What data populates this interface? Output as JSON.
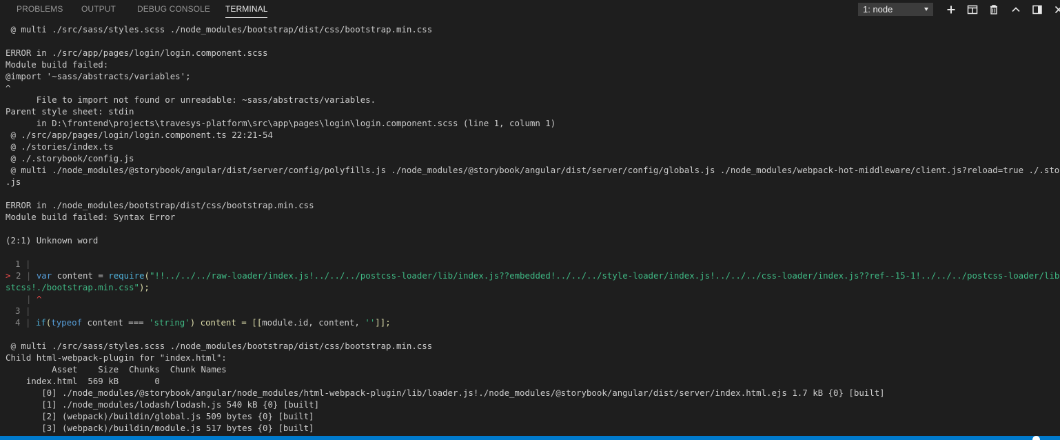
{
  "panel": {
    "tabs": [
      {
        "label": "PROBLEMS",
        "active": false
      },
      {
        "label": "OUTPUT",
        "active": false
      },
      {
        "label": "DEBUG CONSOLE",
        "active": false
      },
      {
        "label": "TERMINAL",
        "active": true
      }
    ],
    "terminal_select": {
      "value": "1: node"
    },
    "actions": [
      {
        "icon": "plus-icon"
      },
      {
        "icon": "split-terminal-icon"
      },
      {
        "icon": "trash-icon"
      },
      {
        "icon": "chevron-up-icon"
      },
      {
        "icon": "maximize-panel-icon"
      },
      {
        "icon": "close-icon"
      }
    ]
  },
  "terminal": {
    "lines": [
      " @ multi ./src/sass/styles.scss ./node_modules/bootstrap/dist/css/bootstrap.min.css",
      "",
      "ERROR in ./src/app/pages/login/login.component.scss",
      "Module build failed:",
      "@import '~sass/abstracts/variables';",
      "^",
      "      File to import not found or unreadable: ~sass/abstracts/variables.",
      "Parent style sheet: stdin",
      "      in D:\\frontend\\projects\\travesys-platform\\src\\app\\pages\\login\\login.component.scss (line 1, column 1)",
      " @ ./src/app/pages/login/login.component.ts 22:21-54",
      " @ ./stories/index.ts",
      " @ ./.storybook/config.js",
      " @ multi ./node_modules/@storybook/angular/dist/server/config/polyfills.js ./node_modules/@storybook/angular/dist/server/config/globals.js ./node_modules/webpack-hot-middleware/client.js?reload=true ./.storybook/config",
      ".js",
      "",
      "ERROR in ./node_modules/bootstrap/dist/css/bootstrap.min.css",
      "Module build failed: Syntax Error",
      "",
      "(2:1) Unknown word",
      ""
    ],
    "code_frame": {
      "l1_num": "1",
      "l2_marker": ">",
      "l2_num": "2",
      "l2_var": "var",
      "l2_content": " content = ",
      "l2_require": "require",
      "l2_paren": "(",
      "l2_str": "\"!!../../../raw-loader/index.js!../../../postcss-loader/lib/index.js??embedded!../../../style-loader/index.js!../../../css-loader/index.js??ref--15-1!../../../postcss-loader/lib/index.js??po",
      "l2b_str": "stcss!./bootstrap.min.css\"",
      "l2b_end": ");",
      "caret": "^",
      "l3_num": "3",
      "l4_num": "4",
      "l4_if": "if",
      "l4_paren": "(",
      "l4_typeof": "typeof",
      "l4_mid": " content === ",
      "l4_str": "'string'",
      "l4_close": ") content = ",
      "l4_br": "[[",
      "l4_args": "module.id, content, ",
      "l4_str2": "''",
      "l4_end": "]];",
      "bar": "|"
    },
    "lines_after": [
      "",
      " @ multi ./src/sass/styles.scss ./node_modules/bootstrap/dist/css/bootstrap.min.css",
      "Child html-webpack-plugin for \"index.html\":",
      "         Asset    Size  Chunks  Chunk Names",
      "    index.html  569 kB       0",
      "       [0] ./node_modules/@storybook/angular/node_modules/html-webpack-plugin/lib/loader.js!./node_modules/@storybook/angular/dist/server/index.html.ejs 1.7 kB {0} [built]",
      "       [1] ./node_modules/lodash/lodash.js 540 kB {0} [built]",
      "       [2] (webpack)/buildin/global.js 509 bytes {0} [built]",
      "       [3] (webpack)/buildin/module.js 517 bytes {0} [built]"
    ]
  }
}
